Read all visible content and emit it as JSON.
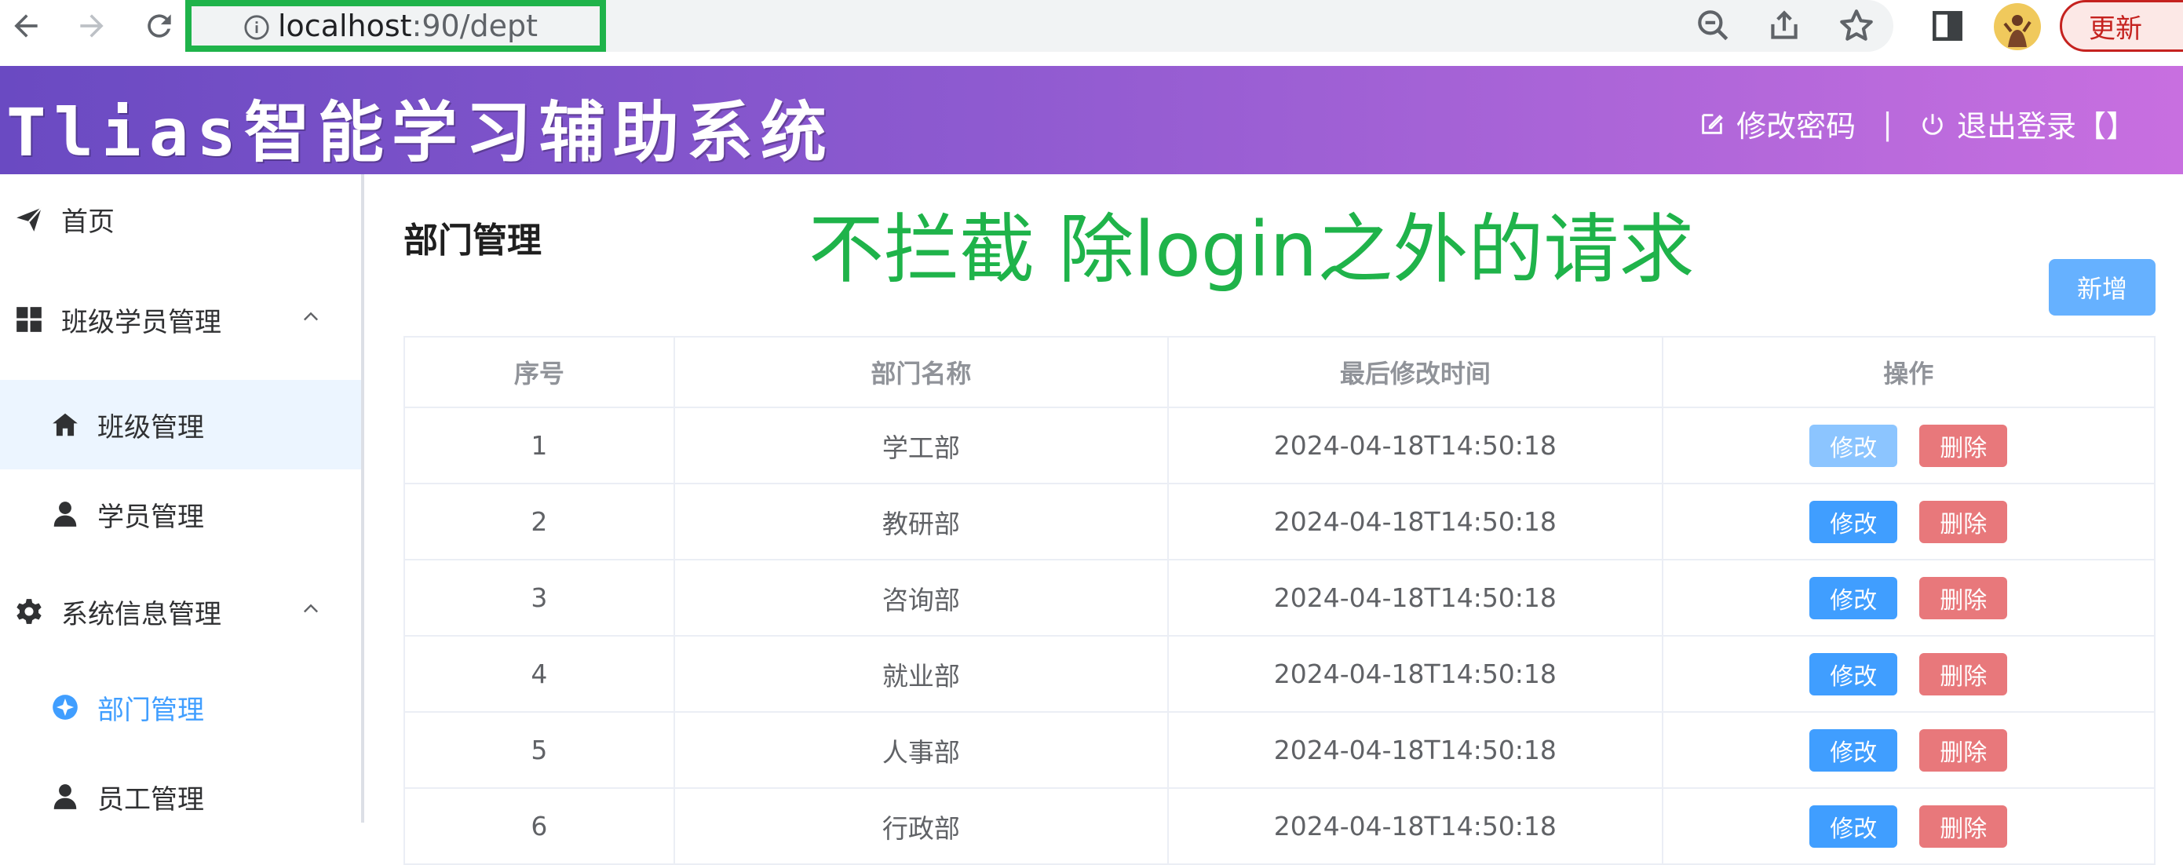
{
  "browser": {
    "url_host": "localhost",
    "url_path": ":90/dept",
    "update_label": "更新"
  },
  "header": {
    "title": "Tlias智能学习辅助系统",
    "change_password": "修改密码",
    "separator": "|",
    "logout": "退出登录【】"
  },
  "sidebar": {
    "home": "首页",
    "group_class": "班级学员管理",
    "class_mgmt": "班级管理",
    "student_mgmt": "学员管理",
    "group_system": "系统信息管理",
    "dept_mgmt": "部门管理",
    "emp_mgmt": "员工管理"
  },
  "main": {
    "page_title": "部门管理",
    "annotation": "不拦截 除login之外的请求",
    "add_label": "新增",
    "columns": [
      "序号",
      "部门名称",
      "最后修改时间",
      "操作"
    ],
    "edit_label": "修改",
    "delete_label": "删除",
    "rows": [
      {
        "index": "1",
        "name": "学工部",
        "updated": "2024-04-18T14:50:18"
      },
      {
        "index": "2",
        "name": "教研部",
        "updated": "2024-04-18T14:50:18"
      },
      {
        "index": "3",
        "name": "咨询部",
        "updated": "2024-04-18T14:50:18"
      },
      {
        "index": "4",
        "name": "就业部",
        "updated": "2024-04-18T14:50:18"
      },
      {
        "index": "5",
        "name": "人事部",
        "updated": "2024-04-18T14:50:18"
      },
      {
        "index": "6",
        "name": "行政部",
        "updated": "2024-04-18T14:50:18"
      }
    ]
  },
  "colors": {
    "accent": "#409eff",
    "danger": "#e8787b",
    "annotation": "#1fb34a",
    "url_highlight": "#1fb34a"
  }
}
